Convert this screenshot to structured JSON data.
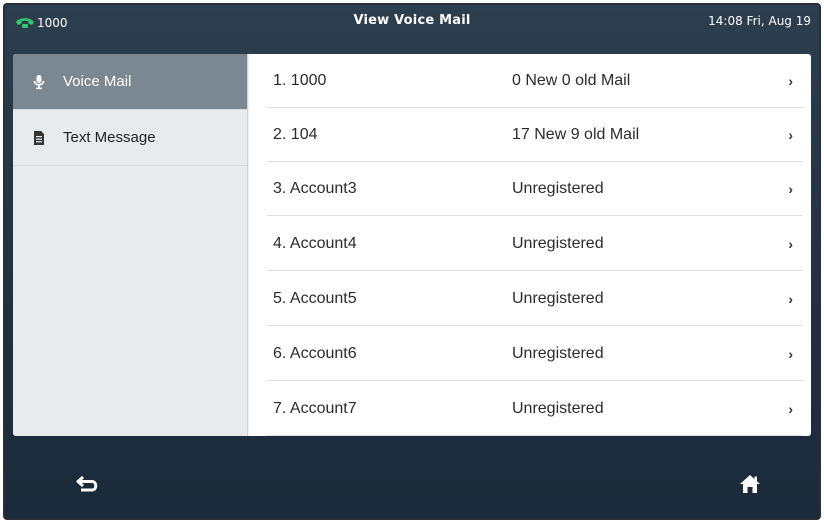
{
  "status_bar": {
    "account_label": "1000",
    "title": "View Voice Mail",
    "datetime": "14:08 Fri, Aug 19"
  },
  "sidebar": {
    "items": [
      {
        "label": "Voice Mail",
        "icon": "microphone-icon",
        "active": true
      },
      {
        "label": "Text Message",
        "icon": "document-icon",
        "active": false
      }
    ]
  },
  "accounts": [
    {
      "name": "1. 1000",
      "status": "0 New 0 old Mail"
    },
    {
      "name": "2. 104",
      "status": "17 New 9 old Mail"
    },
    {
      "name": "3. Account3",
      "status": "Unregistered"
    },
    {
      "name": "4. Account4",
      "status": "Unregistered"
    },
    {
      "name": "5. Account5",
      "status": "Unregistered"
    },
    {
      "name": "6. Account6",
      "status": "Unregistered"
    },
    {
      "name": "7. Account7",
      "status": "Unregistered"
    }
  ],
  "softkeys": {
    "left_icon": "back-arrow-icon",
    "right_icon": "home-icon"
  },
  "colors": {
    "registered_phone": "#2ec96a",
    "active_tab": "#7c8891",
    "frame_bg": "#213142"
  }
}
